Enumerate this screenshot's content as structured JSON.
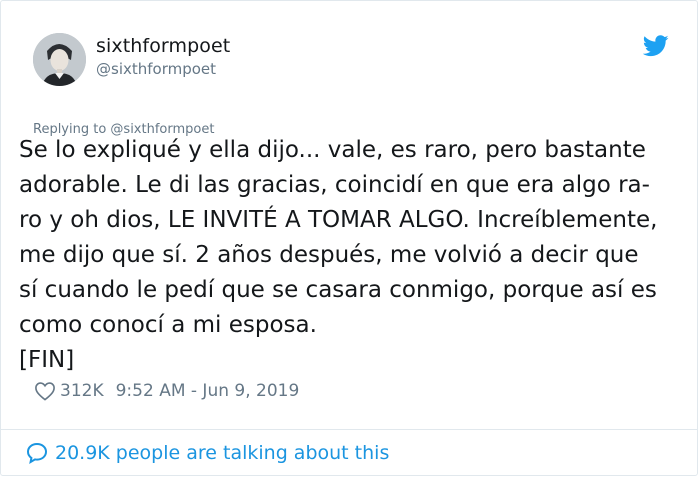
{
  "author": {
    "display_name": "sixthformpoet",
    "handle": "@sixthformpoet"
  },
  "reply_context": "Replying to @sixthformpoet",
  "tweet": {
    "text": "Se lo expliqué y ella dijo... vale, es raro, pero bastante\nadorable. Le di las gracias, coincidí en que era algo ra-\nro y oh dios, LE INVITÉ A TOMAR ALGO. Increíblemente,\nme dijo que sí. 2 años después, me volvió a decir que\nsí cuando le pedí que se casara conmigo, porque así es\ncomo conocí a mi esposa.\n[FIN]"
  },
  "stats": {
    "likes": "312K",
    "timestamp": "9:52 AM - Jun 9, 2019"
  },
  "footer": {
    "talking_text": "20.9K people are talking about this"
  },
  "icons": {
    "brand": "twitter-bird-icon",
    "like": "heart-icon",
    "conversation": "speech-bubble-icon"
  },
  "colors": {
    "brand_blue": "#1da1f2",
    "link_blue": "#1b95e0",
    "text": "#14171a",
    "muted": "#657786",
    "border": "#e1e8ed"
  }
}
